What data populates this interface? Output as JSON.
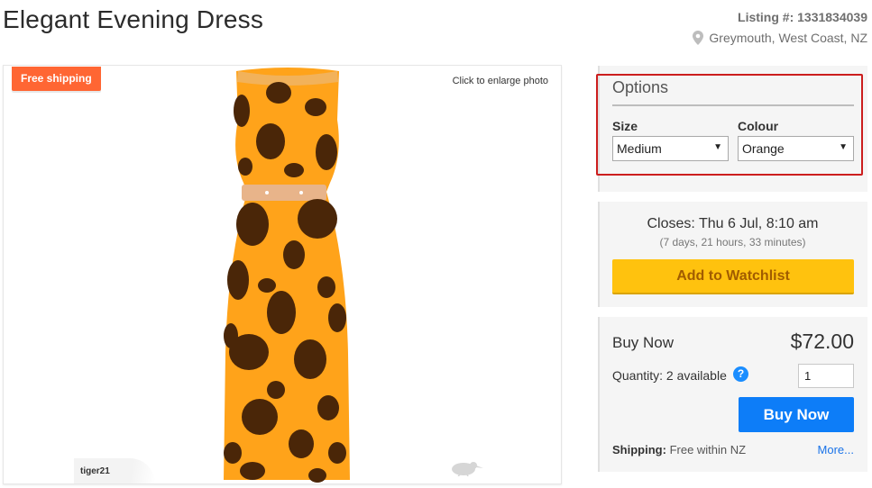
{
  "listing": {
    "title": "Elegant Evening Dress",
    "listing_number": "Listing #: 1331834039",
    "location": "Greymouth, West Coast, NZ"
  },
  "photo": {
    "badge": "Free shipping",
    "enlarge_text": "Click to enlarge photo",
    "watermark": "tiger21",
    "dress_colors": {
      "base": "#ffa31a",
      "spots": "#4a2608",
      "belt": "#e8b48a"
    }
  },
  "options": {
    "title": "Options",
    "size_label": "Size",
    "size_value": "Medium",
    "colour_label": "Colour",
    "colour_value": "Orange",
    "highlight_color": "#cc1e1e"
  },
  "auction": {
    "closes": "Closes: Thu 6 Jul, 8:10 am",
    "countdown": "(7 days, 21 hours, 33 minutes)",
    "watchlist_button": "Add to Watchlist"
  },
  "buy": {
    "label": "Buy Now",
    "price": "$72.00",
    "quantity_label": "Quantity: 2 available",
    "quantity_value": "1",
    "button": "Buy Now",
    "shipping_label": "Shipping:",
    "shipping_value": "Free within NZ",
    "more_link": "More..."
  },
  "colors": {
    "accent_orange": "#ff6633",
    "watchlist_yellow": "#ffc20e",
    "buy_blue": "#0d7df8"
  },
  "icons": [
    "location-pin-icon",
    "help-icon",
    "dropdown-caret-icon",
    "kiwi-icon"
  ]
}
